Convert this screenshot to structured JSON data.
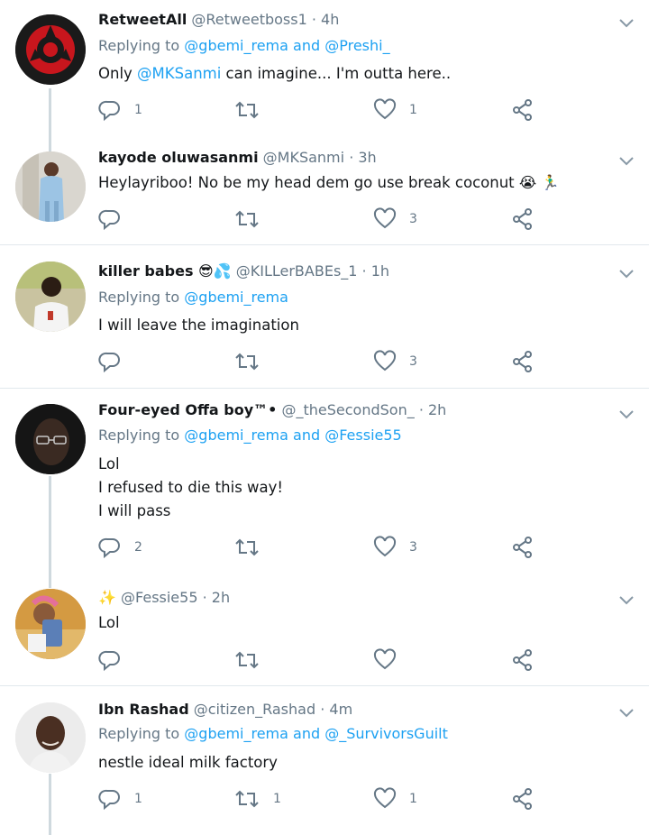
{
  "tweets": [
    {
      "name": "RetweetAll",
      "handle": "@Retweetboss1",
      "sep": "·",
      "time": "4h",
      "replying_prefix": "Replying to ",
      "replying_to": "@gbemi_rema and @Preshi_",
      "text_mention": "@MKSanmi",
      "text_before": "Only ",
      "text_after": " can imagine... I'm outta here..",
      "replies": "1",
      "retweets": "",
      "likes": "1"
    },
    {
      "name": "kayode oluwasanmi",
      "handle": "@MKSanmi",
      "sep": "·",
      "time": "3h",
      "text": "Heylayriboo! No be my head dem go use break coconut 😭 🏃‍♂️",
      "replies": "",
      "retweets": "",
      "likes": "3"
    },
    {
      "name": "killer babes 😎💦",
      "handle": "@KILLerBABEs_1",
      "sep": "·",
      "time": "1h",
      "replying_prefix": "Replying to ",
      "replying_to": "@gbemi_rema",
      "text": "I will leave the imagination",
      "replies": "",
      "retweets": "",
      "likes": "3"
    },
    {
      "name": "Four-eyed Offa boy™•",
      "handle": "@_theSecondSon_",
      "sep": "·",
      "time": "2h",
      "replying_prefix": "Replying to ",
      "replying_to": "@gbemi_rema and @Fessie55",
      "text_lines": [
        "Lol",
        "I refused to die this way!",
        "I will pass"
      ],
      "replies": "2",
      "retweets": "",
      "likes": "3"
    },
    {
      "name": "✨",
      "handle": "@Fessie55",
      "sep": "·",
      "time": "2h",
      "text": "Lol",
      "replies": "",
      "retweets": "",
      "likes": ""
    },
    {
      "name": "Ibn Rashad",
      "handle": "@citizen_Rashad",
      "sep": "·",
      "time": "4m",
      "replying_prefix": "Replying to ",
      "replying_to": "@gbemi_rema and @_SurvivorsGuilt",
      "text": "nestle ideal milk factory",
      "replies": "1",
      "retweets": "1",
      "likes": "1"
    }
  ],
  "icons": {
    "reply": "reply-icon",
    "retweet": "retweet-icon",
    "like": "heart-icon",
    "share": "share-icon",
    "more": "chevron-down-icon"
  },
  "colors": {
    "link": "#1da1f2",
    "muted": "#657786",
    "thread_line": "#cfd9de",
    "divider": "#e1e8ed"
  }
}
